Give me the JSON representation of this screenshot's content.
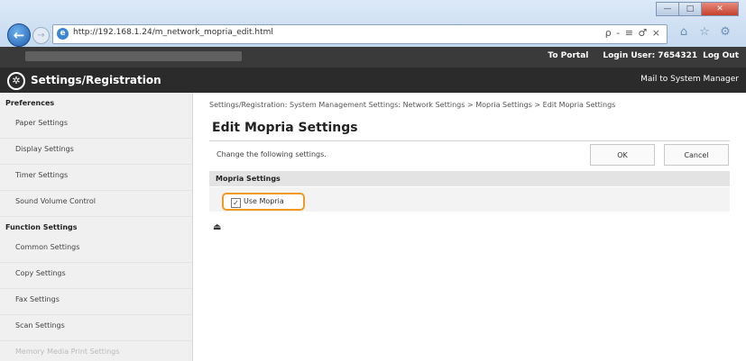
{
  "browser": {
    "url": "http://192.168.1.24/m_network_mopria_edit.html",
    "address_tools": "ρ - ≡ ♂ ×",
    "nav_back_glyph": "←",
    "nav_forward_glyph": "→",
    "window": {
      "minimize": "—",
      "maximize": "□",
      "close": "✕"
    },
    "fav_icons": [
      "home-icon",
      "star-icon",
      "gear-icon"
    ]
  },
  "topbar": {
    "to_portal": "To Portal",
    "login_user": "Login User:  7654321",
    "log_out": "Log Out"
  },
  "header": {
    "title": "Settings/Registration",
    "mail_link": "Mail to System Manager"
  },
  "sidebar": {
    "preferences_heading": "Preferences",
    "preferences": [
      "Paper Settings",
      "Display Settings",
      "Timer Settings",
      "Sound Volume Control"
    ],
    "function_heading": "Function Settings",
    "functions": [
      "Common Settings",
      "Copy Settings",
      "Fax Settings",
      "Scan Settings",
      "Memory Media Print Settings"
    ]
  },
  "main": {
    "breadcrumb": "Settings/Registration: System Management Settings: Network Settings > Mopria Settings > Edit Mopria Settings",
    "title": "Edit Mopria Settings",
    "instruction": "Change the following settings.",
    "ok_label": "OK",
    "cancel_label": "Cancel",
    "section_title": "Mopria Settings",
    "checkbox_label": "Use Mopria",
    "checkbox_checked": true,
    "top_arrow": "⏏"
  },
  "colors": {
    "highlight": "#f29a1f",
    "header_bg": "#2b2b2b"
  }
}
